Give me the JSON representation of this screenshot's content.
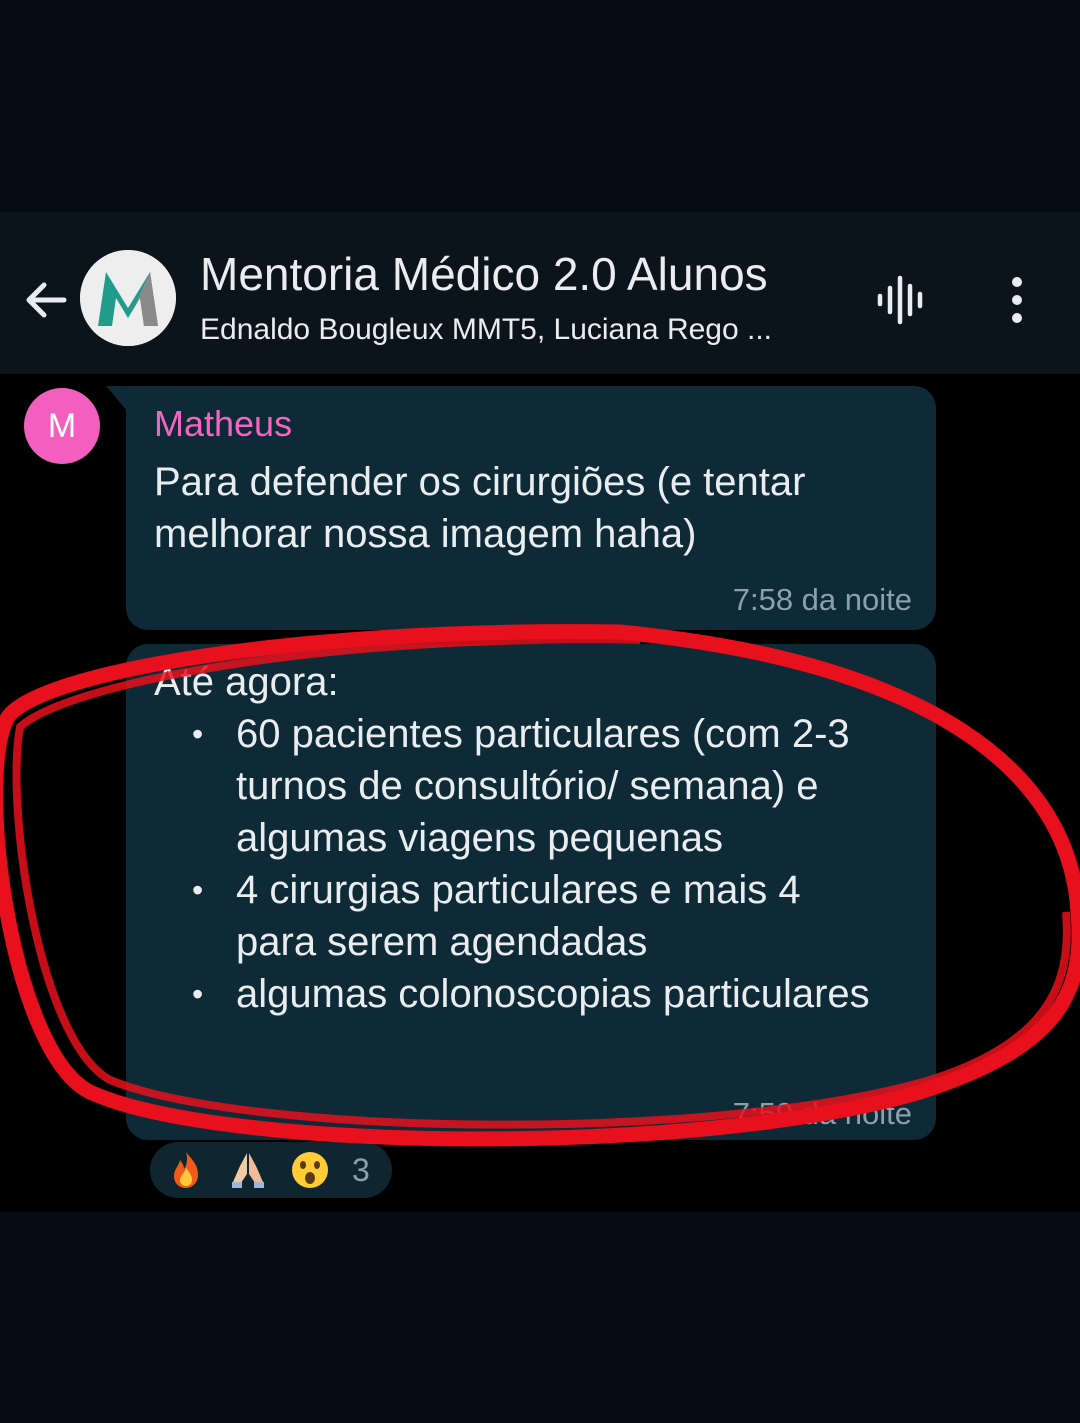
{
  "header": {
    "title": "Mentoria Médico 2.0 Alunos",
    "subtitle": "Ednaldo Bougleux MMT5, Luciana Rego ...",
    "avatar_letter": "M",
    "back_icon": "arrow-left-icon",
    "voice_icon": "voice-chat-icon",
    "menu_icon": "more-vertical-icon"
  },
  "messages": [
    {
      "sender": "Matheus",
      "avatar_letter": "M",
      "text": "Para defender os cirurgiões (e tentar melhorar nossa imagem haha)",
      "time": "7:58 da noite"
    },
    {
      "intro": "Até agora:",
      "items": [
        "60 pacientes particulares (com 2-3 turnos de consultório/ semana) e algumas viagens pequenas",
        "4 cirurgias particulares e mais 4 para serem agendadas",
        "algumas colonoscopias particulares"
      ],
      "time": "7:59 da noite",
      "reactions": {
        "emojis": [
          "fire",
          "folded-hands",
          "astonished-face"
        ],
        "count": "3"
      }
    }
  ],
  "colors": {
    "header_bg": "#0b141a",
    "bubble_bg": "#0d2a36",
    "sender_name": "#f465c2",
    "avatar_bg": "#f35fbf",
    "annotation": "#e8101c"
  }
}
